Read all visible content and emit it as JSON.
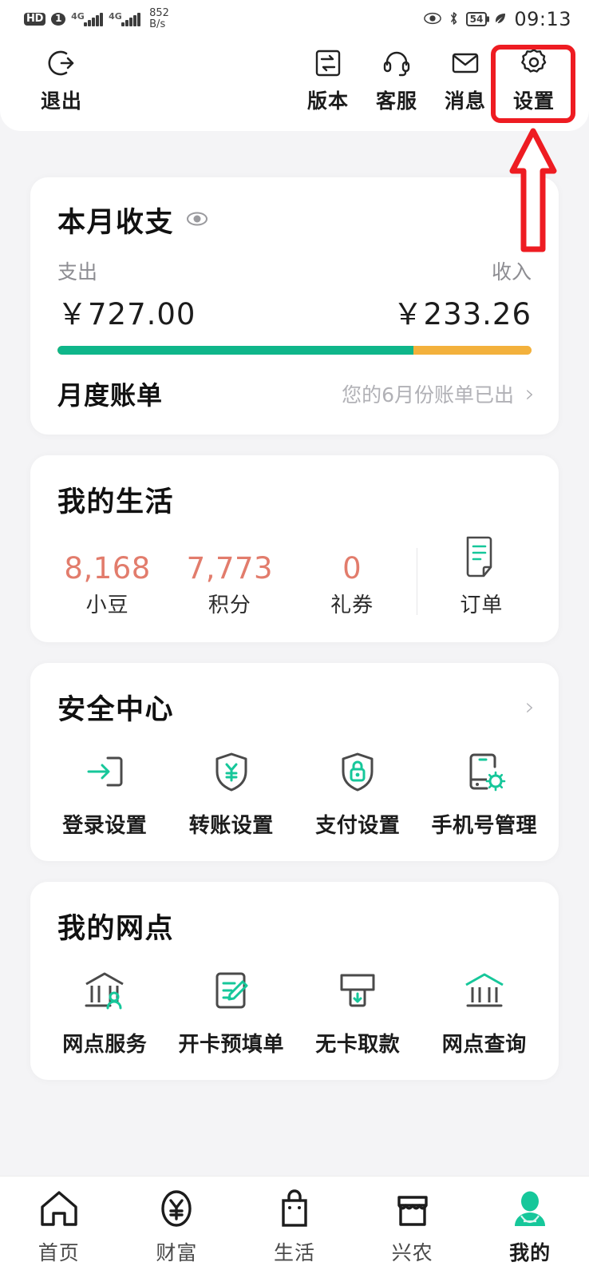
{
  "status_bar": {
    "hd_badge": "HD",
    "sim_badge": "1",
    "net_label_1": "4G",
    "net_label_2": "4G",
    "net_speed_value": "852",
    "net_speed_unit": "B/s",
    "battery_percent": "54",
    "time": "09:13",
    "icons": [
      "eye-care-icon",
      "bluetooth-icon",
      "battery-icon",
      "power-saving-icon"
    ]
  },
  "header": {
    "logout": {
      "label": "退出",
      "icon": "logout-icon"
    },
    "actions": [
      {
        "label": "版本",
        "icon": "version-icon"
      },
      {
        "label": "客服",
        "icon": "headset-icon"
      },
      {
        "label": "消息",
        "icon": "envelope-icon"
      },
      {
        "label": "设置",
        "icon": "gear-icon"
      }
    ]
  },
  "income_expense": {
    "title": "本月收支",
    "eye_icon": "eye-icon",
    "expense_label": "支出",
    "income_label": "收入",
    "expense_value": "￥727.00",
    "income_value": "￥233.26",
    "bar": {
      "expense_percent": 75,
      "income_percent": 25,
      "expense_color": "#0fb68a",
      "income_color": "#f3b13c"
    },
    "bill_title": "月度账单",
    "bill_note": "您的6月份账单已出",
    "chevron": "›"
  },
  "my_life": {
    "title": "我的生活",
    "stats": [
      {
        "value": "8,168",
        "label": "小豆"
      },
      {
        "value": "7,773",
        "label": "积分"
      },
      {
        "value": "0",
        "label": "礼券"
      }
    ],
    "order": {
      "label": "订单",
      "icon": "order-document-icon"
    },
    "number_color": "#e27c6c"
  },
  "security_center": {
    "title": "安全中心",
    "chevron": "›",
    "items": [
      {
        "label": "登录设置",
        "icon": "login-settings-icon"
      },
      {
        "label": "转账设置",
        "icon": "transfer-shield-icon"
      },
      {
        "label": "支付设置",
        "icon": "payment-lock-shield-icon"
      },
      {
        "label": "手机号管理",
        "icon": "phone-gear-icon"
      }
    ]
  },
  "my_branch": {
    "title": "我的网点",
    "items": [
      {
        "label": "网点服务",
        "icon": "bank-person-icon"
      },
      {
        "label": "开卡预填单",
        "icon": "form-pen-icon"
      },
      {
        "label": "无卡取款",
        "icon": "atm-withdraw-icon"
      },
      {
        "label": "网点查询",
        "icon": "bank-search-icon"
      }
    ]
  },
  "bottom_nav": {
    "items": [
      {
        "label": "首页",
        "icon": "home-icon",
        "active": false
      },
      {
        "label": "财富",
        "icon": "yuan-circle-icon",
        "active": false
      },
      {
        "label": "生活",
        "icon": "shopping-bag-icon",
        "active": false
      },
      {
        "label": "兴农",
        "icon": "store-icon",
        "active": false
      },
      {
        "label": "我的",
        "icon": "person-avatar-icon",
        "active": true
      }
    ],
    "active_color": "#16c79a"
  },
  "annotation": {
    "highlight_target": "设置",
    "box_color": "#ee1c22",
    "arrow": "up-arrow"
  }
}
